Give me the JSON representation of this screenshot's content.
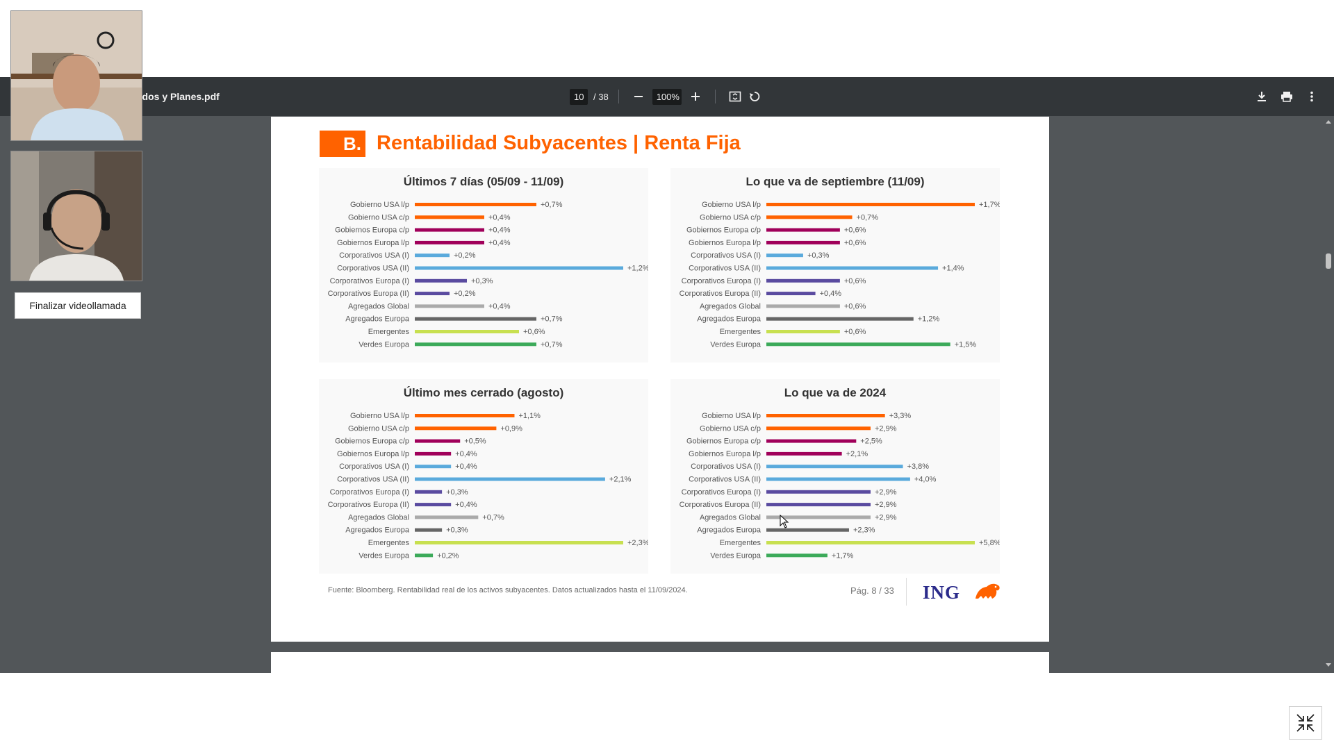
{
  "viewer": {
    "file_name": "ndos y Planes.pdf",
    "page_current": "10",
    "page_total": "/ 38",
    "zoom": "100%"
  },
  "video_call": {
    "end_button": "Finalizar videollamada"
  },
  "slide": {
    "badge": "B.",
    "title": "Rentabilidad Subyacentes | Renta Fija",
    "source": "Fuente: Bloomberg. Rentabilidad real de los activos subyacentes. Datos actualizados hasta el 11/09/2024.",
    "page_label": "Pág. 8 / 33",
    "logo": "ING"
  },
  "colors": {
    "orange": "#ff6200",
    "purple": "#a0005a",
    "blue": "#5aaadc",
    "indigo": "#5a4ba0",
    "gray": "#aaaaaa",
    "darkgray": "#666666",
    "yellowgreen": "#c8e050",
    "green": "#3caa5a",
    "viewer_bg": "#525659",
    "toolbar_bg": "#323639"
  },
  "chart_data": [
    {
      "type": "bar",
      "title": "Últimos 7 días (05/09 - 11/09)",
      "categories": [
        "Gobierno USA l/p",
        "Gobierno USA c/p",
        "Gobiernos Europa c/p",
        "Gobiernos Europa l/p",
        "Corporativos USA (I)",
        "Corporativos USA (II)",
        "Corporativos Europa (I)",
        "Corporativos Europa (II)",
        "Agregados Global",
        "Agregados Europa",
        "Emergentes",
        "Verdes Europa"
      ],
      "values": [
        0.7,
        0.4,
        0.4,
        0.4,
        0.2,
        1.2,
        0.3,
        0.2,
        0.4,
        0.7,
        0.6,
        0.7
      ],
      "labels": [
        "+0,7%",
        "+0,4%",
        "+0,4%",
        "+0,4%",
        "+0,2%",
        "+1,2%",
        "+0,3%",
        "+0,2%",
        "+0,4%",
        "+0,7%",
        "+0,6%",
        "+0,7%"
      ],
      "scale_max": 1.2
    },
    {
      "type": "bar",
      "title": "Lo que va de septiembre (11/09)",
      "categories": [
        "Gobierno USA l/p",
        "Gobierno USA c/p",
        "Gobiernos Europa c/p",
        "Gobiernos Europa l/p",
        "Corporativos USA (I)",
        "Corporativos USA (II)",
        "Corporativos Europa (I)",
        "Corporativos Europa (II)",
        "Agregados Global",
        "Agregados Europa",
        "Emergentes",
        "Verdes Europa"
      ],
      "values": [
        1.7,
        0.7,
        0.6,
        0.6,
        0.3,
        1.4,
        0.6,
        0.4,
        0.6,
        1.2,
        0.6,
        1.5
      ],
      "labels": [
        "+1,7%",
        "+0,7%",
        "+0,6%",
        "+0,6%",
        "+0,3%",
        "+1,4%",
        "+0,6%",
        "+0,4%",
        "+0,6%",
        "+1,2%",
        "+0,6%",
        "+1,5%"
      ],
      "scale_max": 1.7
    },
    {
      "type": "bar",
      "title": "Último mes cerrado (agosto)",
      "categories": [
        "Gobierno USA l/p",
        "Gobierno USA c/p",
        "Gobiernos Europa c/p",
        "Gobiernos Europa l/p",
        "Corporativos USA (I)",
        "Corporativos USA (II)",
        "Corporativos Europa (I)",
        "Corporativos Europa (II)",
        "Agregados Global",
        "Agregados Europa",
        "Emergentes",
        "Verdes Europa"
      ],
      "values": [
        1.1,
        0.9,
        0.5,
        0.4,
        0.4,
        2.1,
        0.3,
        0.4,
        0.7,
        0.3,
        2.3,
        0.2
      ],
      "labels": [
        "+1,1%",
        "+0,9%",
        "+0,5%",
        "+0,4%",
        "+0,4%",
        "+2,1%",
        "+0,3%",
        "+0,4%",
        "+0,7%",
        "+0,3%",
        "+2,3%",
        "+0,2%"
      ],
      "scale_max": 2.3
    },
    {
      "type": "bar",
      "title": "Lo que va de 2024",
      "categories": [
        "Gobierno USA l/p",
        "Gobierno USA c/p",
        "Gobiernos Europa c/p",
        "Gobiernos Europa l/p",
        "Corporativos USA (I)",
        "Corporativos USA (II)",
        "Corporativos Europa (I)",
        "Corporativos Europa (II)",
        "Agregados Global",
        "Agregados Europa",
        "Emergentes",
        "Verdes Europa"
      ],
      "values": [
        3.3,
        2.9,
        2.5,
        2.1,
        3.8,
        4.0,
        2.9,
        2.9,
        2.9,
        2.3,
        5.8,
        1.7
      ],
      "labels": [
        "+3,3%",
        "+2,9%",
        "+2,5%",
        "+2,1%",
        "+3,8%",
        "+4,0%",
        "+2,9%",
        "+2,9%",
        "+2,9%",
        "+2,3%",
        "+5,8%",
        "+1,7%"
      ],
      "scale_max": 5.8
    }
  ],
  "bar_color_keys": [
    "orange",
    "orange",
    "purple",
    "purple",
    "blue",
    "blue",
    "indigo",
    "indigo",
    "gray",
    "darkgray",
    "yellowgreen",
    "green"
  ]
}
